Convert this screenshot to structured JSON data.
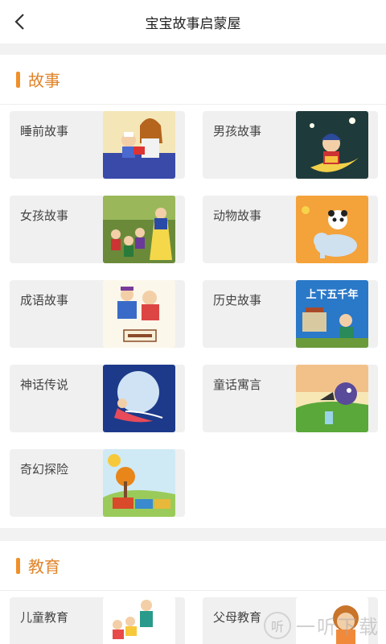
{
  "header": {
    "title": "宝宝故事启蒙屋"
  },
  "sections": [
    {
      "title": "故事",
      "items": [
        {
          "label": "睡前故事"
        },
        {
          "label": "男孩故事"
        },
        {
          "label": "女孩故事"
        },
        {
          "label": "动物故事"
        },
        {
          "label": "成语故事"
        },
        {
          "label": "历史故事",
          "thumb_text": "上下五千年"
        },
        {
          "label": "神话传说"
        },
        {
          "label": "童话寓言"
        },
        {
          "label": "奇幻探险"
        }
      ]
    },
    {
      "title": "教育",
      "items": [
        {
          "label": "儿童教育"
        },
        {
          "label": "父母教育"
        }
      ]
    }
  ],
  "watermark": {
    "text": "一听下载"
  }
}
